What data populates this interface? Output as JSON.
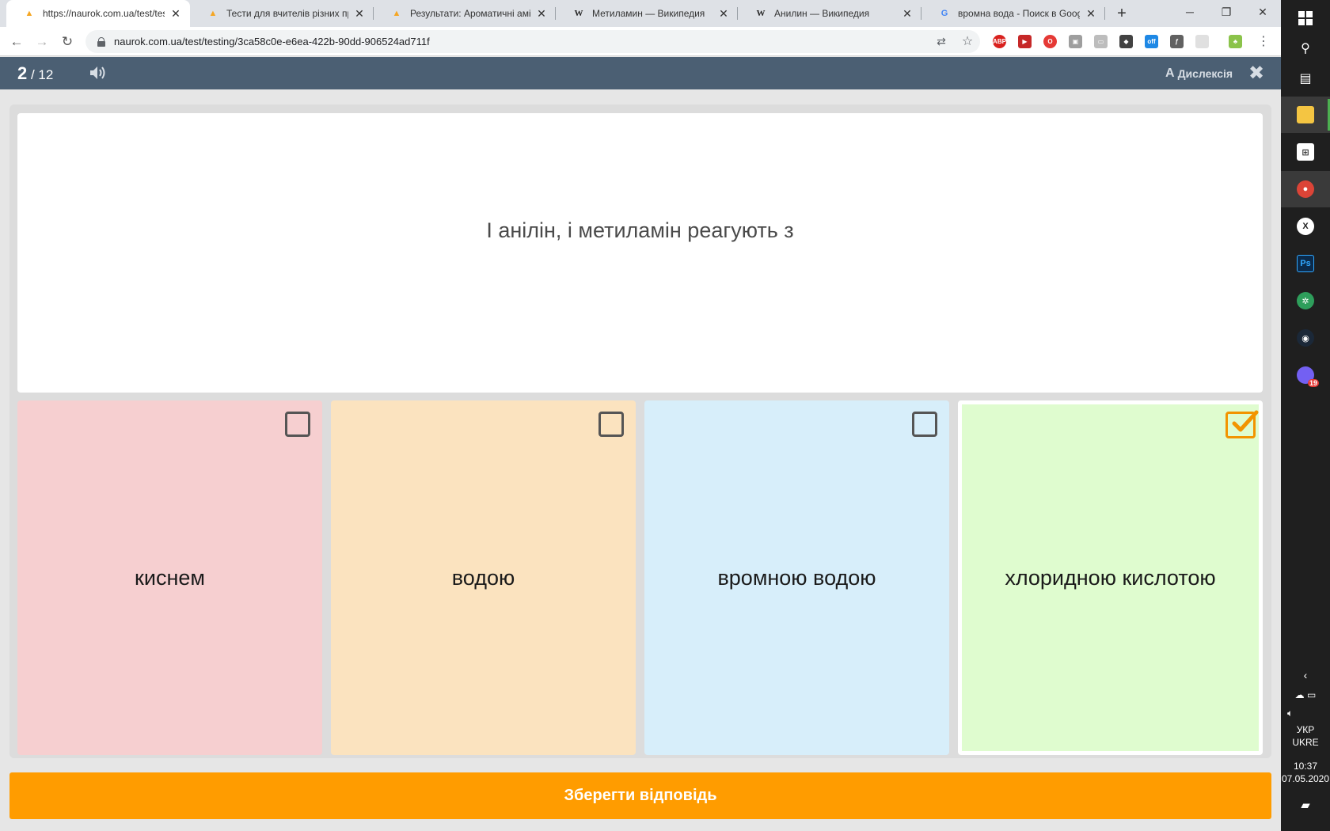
{
  "browser": {
    "tabs": [
      {
        "title": "https://naurok.com.ua/test/testi",
        "icon": "naurok-bell-icon",
        "active": true
      },
      {
        "title": "Тести для вчителів різних пре",
        "icon": "naurok-bell-icon",
        "active": false
      },
      {
        "title": "Результати: Ароматичні аміни",
        "icon": "naurok-bell-icon",
        "active": false
      },
      {
        "title": "Метиламин — Википедия",
        "icon": "wikipedia-icon",
        "active": false
      },
      {
        "title": "Анилин — Википедия",
        "icon": "wikipedia-icon",
        "active": false
      },
      {
        "title": "вромна вода - Поиск в Google",
        "icon": "google-icon",
        "active": false
      }
    ],
    "url": "naurok.com.ua/test/testing/3ca58c0e-e6ea-422b-90dd-906524ad711f",
    "extensions": [
      "ABP",
      "off"
    ]
  },
  "test": {
    "current": "2",
    "separator": " / ",
    "total": "12",
    "dyslexia_label": "Дислексія",
    "dyslexia_icon_letter": "A",
    "question": "І анілін, і метиламін реагують з",
    "options": [
      {
        "label": "киснем",
        "selected": false,
        "color": "#f6cfd0"
      },
      {
        "label": "водою",
        "selected": false,
        "color": "#fbe3bf"
      },
      {
        "label": "вромною водою",
        "selected": false,
        "color": "#d7eefa"
      },
      {
        "label": "хлоридною кислотою",
        "selected": true,
        "color": "#dffccf"
      }
    ],
    "save_button": "Зберегти відповідь",
    "colors": {
      "header": "#4b5f73",
      "save": "#ff9c00",
      "check": "#f29400"
    }
  },
  "taskbar": {
    "viber_badge": "19",
    "lang_line1": "УКР",
    "lang_line2": "UKRE",
    "time": "10:37",
    "date": "07.05.2020"
  }
}
